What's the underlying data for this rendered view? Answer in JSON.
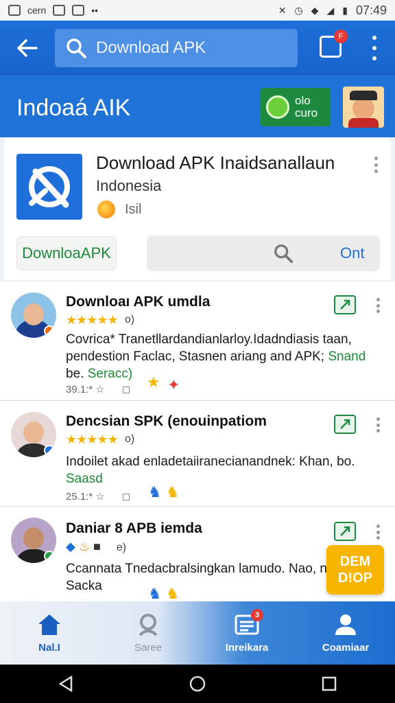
{
  "status_bar": {
    "left_text": "cern",
    "time": "07:49"
  },
  "search": {
    "placeholder": "Download APK"
  },
  "tabs_badge": "F",
  "header": {
    "title": "Indoaá AIK",
    "promo_text_1": "olo",
    "promo_text_2": "curo"
  },
  "app": {
    "title": "Download APK Inaidsanallaun",
    "subtitle": "Indonesia",
    "meta": "Isil",
    "download_label": "DownloaAPK",
    "search_option": "Ont"
  },
  "list": [
    {
      "title": "Downloaı APK umdla",
      "stars": "★★★★★",
      "rating": "o)",
      "desc_main": "Covrica* Tranetllardandianlarloy.Idadndiasis taan, pendestion Faclac, Stasnen ariang and APK; ",
      "desc_hl_1": "Snand",
      "desc_tail": " be. ",
      "desc_hl_2": "Seracc)",
      "foot": "39.1:* ☆"
    },
    {
      "title": "Dencsian SPK (enouinpatiom",
      "stars": "★★★★★",
      "rating": "o)",
      "desc_main": "Indoilet akad enladetaiiranecianandnek: Khan, bo. ",
      "desc_hl_1": "Saasd",
      "foot": "25.1:* ☆"
    },
    {
      "title": "Daniar 8 APB iemda",
      "rating": "e)",
      "desc_main": "Ccannata Tnedacbralsingkan lamudo. Nao, node Sacka"
    }
  ],
  "dem_badge": {
    "line1": "DEM",
    "line2": "D!OP"
  },
  "bottom_nav": [
    {
      "label": "Nal.I",
      "icon": "home-icon"
    },
    {
      "label": "Saree",
      "icon": "search-icon"
    },
    {
      "label": "Inreikara",
      "icon": "updates-icon",
      "badge": "3"
    },
    {
      "label": "Coamiaar",
      "icon": "account-icon"
    }
  ],
  "colors": {
    "primary": "#1e6fd9",
    "accent_green": "#1e8a3f",
    "star": "#f4b400",
    "badge_red": "#e53935"
  }
}
